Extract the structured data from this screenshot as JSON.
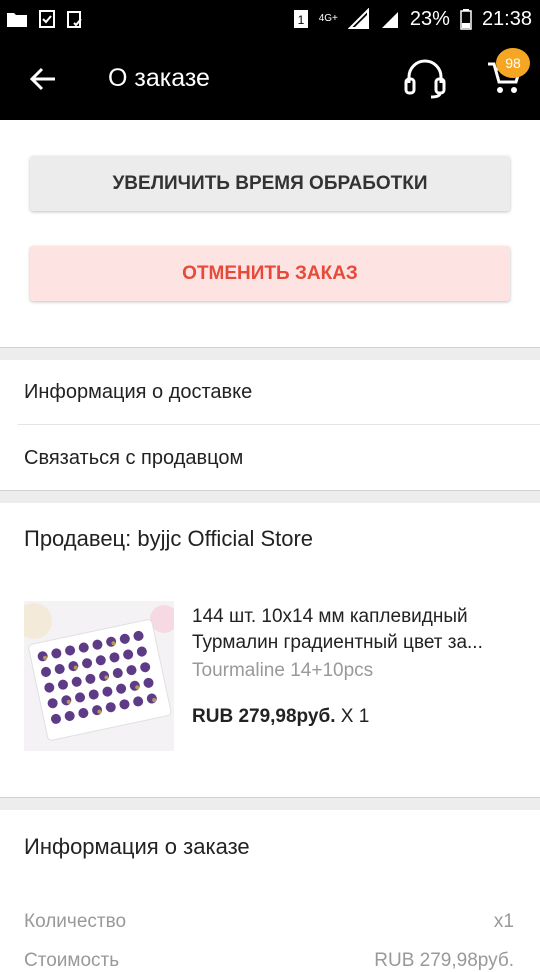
{
  "status_bar": {
    "battery": "23%",
    "time": "21:38",
    "network": "4G+",
    "sim": "1",
    "icons": [
      "folder-icon",
      "checkbox-icon",
      "clipboard-check-icon",
      "sim-icon",
      "signal-icon",
      "battery-icon"
    ]
  },
  "toolbar": {
    "title": "О заказе",
    "cart_count": "98",
    "icons": [
      "back-arrow-icon",
      "headset-icon",
      "cart-icon"
    ]
  },
  "actions": {
    "extend_label": "УВЕЛИЧИТЬ ВРЕМЯ ОБРАБОТКИ",
    "cancel_label": "ОТМЕНИТЬ ЗАКАЗ"
  },
  "links": {
    "delivery_info": "Информация о доставке",
    "contact_seller": "Связаться с продавцом"
  },
  "seller": {
    "label": "Продавец: byjjc Official Store"
  },
  "product": {
    "title_line1": "144 шт. 10x14 мм каплевидный",
    "title_line2": "Турмалин градиентный цвет за...",
    "variant": "Tourmaline 14+10pcs",
    "price": "RUB 279,98руб.",
    "quantity": "X 1"
  },
  "order_info": {
    "title": "Информация о заказе",
    "rows": [
      {
        "label": "Количество",
        "value": "x1"
      },
      {
        "label": "Стоимость",
        "value": "RUB 279,98руб."
      }
    ]
  },
  "colors": {
    "bar": "#000000",
    "badge": "#f5a623",
    "cancel_text": "#e64a3b",
    "cancel_bg": "#fde3e1"
  }
}
